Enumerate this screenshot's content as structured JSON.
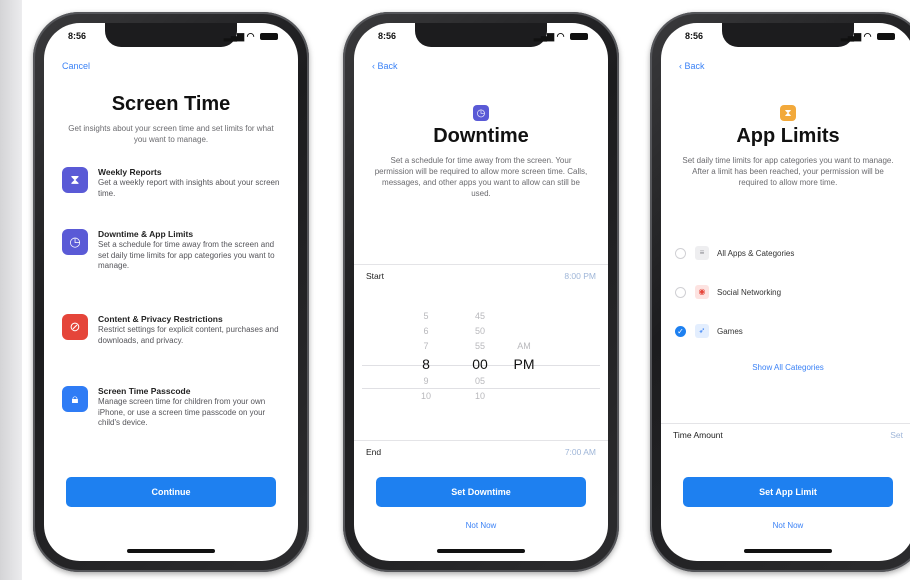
{
  "status_bar": {
    "time": "8:56",
    "signal": "▂▄▆",
    "wifi": "◠"
  },
  "phone1": {
    "nav": "Cancel",
    "title": "Screen Time",
    "subtitle": "Get insights about your screen time and set limits for what you want to manage.",
    "features": [
      {
        "icon": "hourglass-icon",
        "color": "#5a5ad6",
        "title": "Weekly Reports",
        "desc": "Get a weekly report with insights about your screen time."
      },
      {
        "icon": "clock-icon",
        "color": "#5a5ad6",
        "title": "Downtime & App Limits",
        "desc": "Set a schedule for time away from the screen and set daily time limits for app categories you want to manage."
      },
      {
        "icon": "block-icon",
        "color": "#e5453a",
        "title": "Content & Privacy Restrictions",
        "desc": "Restrict settings for explicit content, purchases and downloads, and privacy."
      },
      {
        "icon": "lock-icon",
        "color": "#2f7cf5",
        "title": "Screen Time Passcode",
        "desc": "Manage screen time for children from your own iPhone, or use a screen time passcode on your child's device."
      }
    ],
    "button": "Continue"
  },
  "phone2": {
    "nav": "‹ Back",
    "icon_color": "#5a5ad6",
    "title": "Downtime",
    "subtitle": "Set a schedule for time away from the screen. Your permission will be required to allow more screen time. Calls, messages, and other apps you want to allow can still be used.",
    "start_label": "Start",
    "start_value": "8:00 PM",
    "picker": {
      "hours": [
        "5",
        "6",
        "7",
        "8",
        "9",
        "10"
      ],
      "minutes": [
        "45",
        "50",
        "55",
        "00",
        "05",
        "10"
      ],
      "period": [
        "AM",
        "PM"
      ],
      "selected_hour": "8",
      "selected_minute": "00",
      "selected_period": "PM"
    },
    "end_label": "End",
    "end_value": "7:00 AM",
    "button": "Set Downtime",
    "link": "Not Now"
  },
  "phone3": {
    "nav": "‹ Back",
    "icon_color": "#f2a93b",
    "title": "App Limits",
    "subtitle": "Set daily time limits for app categories you want to manage. After a limit has been reached, your permission will be required to allow more time.",
    "options": [
      {
        "label": "All Apps & Categories",
        "icon_color": "#8e8e93",
        "selected": false
      },
      {
        "label": "Social Networking",
        "icon_color": "#e5453a",
        "selected": false
      },
      {
        "label": "Games",
        "icon_color": "#2f7cf5",
        "selected": true
      }
    ],
    "show_all": "Show All Categories",
    "time_label": "Time Amount",
    "time_value": "Set",
    "button": "Set App Limit",
    "link": "Not Now"
  }
}
